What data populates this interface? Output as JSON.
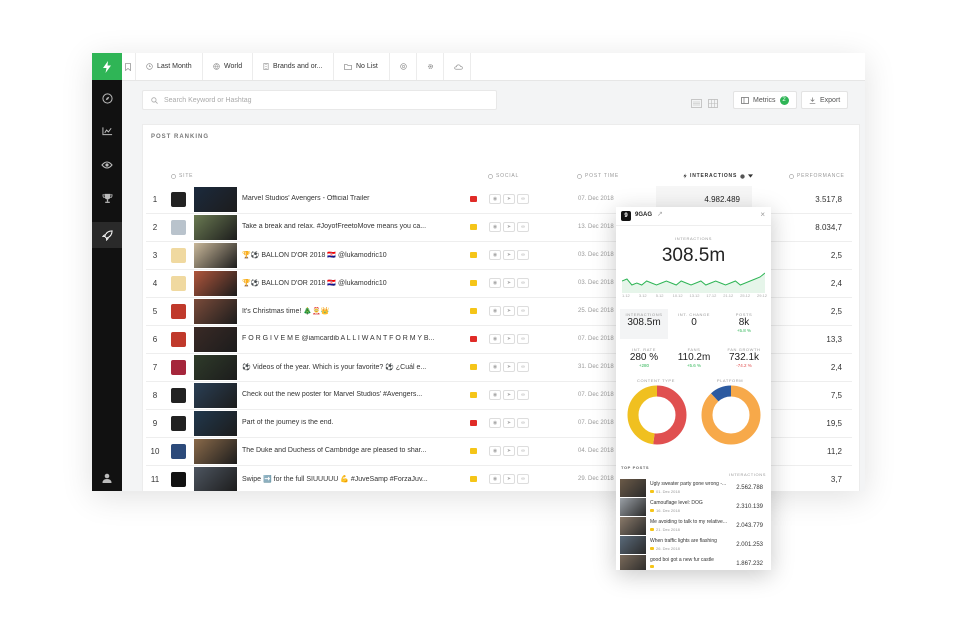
{
  "colors": {
    "brand_green": "#2fb556",
    "youtube": "#e02b27",
    "instagram": "#f5c518",
    "sidebar": "#111111",
    "donut_red": "#e05050",
    "donut_yellow": "#f0c020",
    "donut_orange": "#f7a94a",
    "donut_blue": "#2c5aa0"
  },
  "sidebar": {
    "items": [
      {
        "icon": "compass-icon"
      },
      {
        "icon": "chart-icon"
      },
      {
        "icon": "eye-icon"
      },
      {
        "icon": "trophy-icon"
      },
      {
        "icon": "rocket-icon"
      },
      {
        "icon": "user-icon"
      }
    ]
  },
  "filters": {
    "period": "Last Month",
    "region": "World",
    "category": "Brands and or...",
    "list": "No List"
  },
  "search": {
    "placeholder": "Search Keyword or Hashtag"
  },
  "toolbar": {
    "metrics_label": "Metrics",
    "metrics_count": "2",
    "export_label": "Export"
  },
  "ranking": {
    "title": "POST RANKING",
    "columns": {
      "site": "SITE",
      "social": "SOCIAL",
      "post_time": "POST TIME",
      "interactions": "INTERACTIONS",
      "performance": "PERFORMANCE"
    },
    "rows": [
      {
        "rank": "1",
        "avatar": "#222222",
        "thumb": "#1b2a3d",
        "text": "Marvel Studios' Avengers - Official Trailer",
        "network": "youtube",
        "date": "07. Dec 2018",
        "interactions": "4.982.489",
        "performance": "3.517,8"
      },
      {
        "rank": "2",
        "avatar": "#b9c3cc",
        "thumb": "#6a7a52",
        "text": "Take a break and relax. #JoyofFreetoMove means you ca...",
        "network": "instagram",
        "date": "13. Dec 2018",
        "interactions": "",
        "performance": "8.034,7"
      },
      {
        "rank": "3",
        "avatar": "#f0d9a0",
        "thumb": "#c9b89a",
        "text": "🏆⚽ BALLON D'OR 2018 🇭🇷 @lukamodric10",
        "network": "instagram",
        "date": "03. Dec 2018",
        "interactions": "",
        "performance": "2,5"
      },
      {
        "rank": "4",
        "avatar": "#f0d9a0",
        "thumb": "#b0563c",
        "text": "🏆⚽ BALLON D'OR 2018 🇭🇷 @lukamodric10",
        "network": "instagram",
        "date": "03. Dec 2018",
        "interactions": "",
        "performance": "2,4"
      },
      {
        "rank": "5",
        "avatar": "#c0392b",
        "thumb": "#7a4b3a",
        "text": "It's Christmas time! 🎄🤶👑",
        "network": "instagram",
        "date": "25. Dec 2018",
        "interactions": "",
        "performance": "2,5"
      },
      {
        "rank": "6",
        "avatar": "#c0392b",
        "thumb": "#3a2a26",
        "text": "F O R G I V E M E @iamcardib A L L I W A N T F O R M Y B...",
        "network": "youtube",
        "date": "07. Dec 2018",
        "interactions": "",
        "performance": "13,3"
      },
      {
        "rank": "7",
        "avatar": "#a5263b",
        "thumb": "#2f3b2a",
        "text": "⚽ Videos of the year. Which is your favorite? ⚽ ¿Cuál e...",
        "network": "instagram",
        "date": "31. Dec 2018",
        "interactions": "",
        "performance": "2,4"
      },
      {
        "rank": "8",
        "avatar": "#222222",
        "thumb": "#2a3f55",
        "text": "Check out the new poster for Marvel Studios' #Avengers...",
        "network": "instagram",
        "date": "07. Dec 2018",
        "interactions": "",
        "performance": "7,5"
      },
      {
        "rank": "9",
        "avatar": "#222222",
        "thumb": "#21384d",
        "text": "Part of the journey is the end.",
        "network": "youtube",
        "date": "07. Dec 2018",
        "interactions": "",
        "performance": "19,5"
      },
      {
        "rank": "10",
        "avatar": "#2c4a7a",
        "thumb": "#8a6a4a",
        "text": "The Duke and Duchess of Cambridge are pleased to shar...",
        "network": "instagram",
        "date": "04. Dec 2018",
        "interactions": "",
        "performance": "11,2"
      },
      {
        "rank": "11",
        "avatar": "#111111",
        "thumb": "#4d5560",
        "text": "Swipe ➡️ for the full SIUUUUU 💪 #JuveSamp #ForzaJuv...",
        "network": "instagram",
        "date": "29. Dec 2018",
        "interactions": "",
        "performance": "3,7"
      }
    ]
  },
  "popup": {
    "account": "9GAG",
    "interactions_label": "INTERACTIONS",
    "interactions_total": "308.5m",
    "spark_labels": [
      "1.12",
      "3.12",
      "5.12",
      "10.12",
      "13.12",
      "17.12",
      "21.12",
      "25.12",
      "29.12"
    ],
    "sparkline": [
      46,
      47,
      44,
      45,
      44,
      46,
      45,
      44,
      45,
      46,
      45,
      44,
      46,
      45,
      44,
      45,
      46,
      44,
      45,
      46,
      45,
      44,
      45,
      46,
      44,
      45,
      46,
      47,
      48,
      50
    ],
    "stats_row1": [
      {
        "label": "INTERACTIONS",
        "value": "308.5m",
        "delta": ""
      },
      {
        "label": "INT. CHANGE",
        "value": "0",
        "delta": ""
      },
      {
        "label": "POSTS",
        "value": "8k",
        "delta": "+5.8 %"
      }
    ],
    "stats_row2": [
      {
        "label": "INT. RATE",
        "value": "280 %",
        "delta": "+280"
      },
      {
        "label": "FANS",
        "value": "110.2m",
        "delta": "+5.6 %"
      },
      {
        "label": "FAN GROWTH",
        "value": "732.1k",
        "delta": "-74.2 %"
      }
    ],
    "donuts": [
      {
        "label": "CONTENT TYPE",
        "segments": [
          {
            "share": 0.52,
            "color": "#e05050"
          },
          {
            "share": 0.48,
            "color": "#f0c020"
          }
        ]
      },
      {
        "label": "PLATFORM",
        "segments": [
          {
            "share": 0.88,
            "color": "#f7a94a"
          },
          {
            "share": 0.12,
            "color": "#2c5aa0"
          }
        ]
      }
    ],
    "top_posts_label": "TOP POSTS",
    "top_posts_metric": "INTERACTIONS",
    "top_posts": [
      {
        "text": "Ugly sweater party gone wrong -...",
        "date": "01. Dec 2018",
        "value": "2.562.788",
        "thumb": "#6b5a48"
      },
      {
        "text": "Camouflage level: DOG",
        "date": "16. Dec 2018",
        "value": "2.310.139",
        "thumb": "#9aa0a6"
      },
      {
        "text": "Me avoiding to talk to my relative...",
        "date": "21. Dec 2018",
        "value": "2.043.779",
        "thumb": "#8a7a6a"
      },
      {
        "text": "When traffic lights are flashing",
        "date": "26. Dec 2018",
        "value": "2.001.253",
        "thumb": "#5a6a7a"
      },
      {
        "text": "good boi got a new fur castle",
        "date": "",
        "value": "1.867.232",
        "thumb": "#7a6a5a"
      }
    ]
  }
}
